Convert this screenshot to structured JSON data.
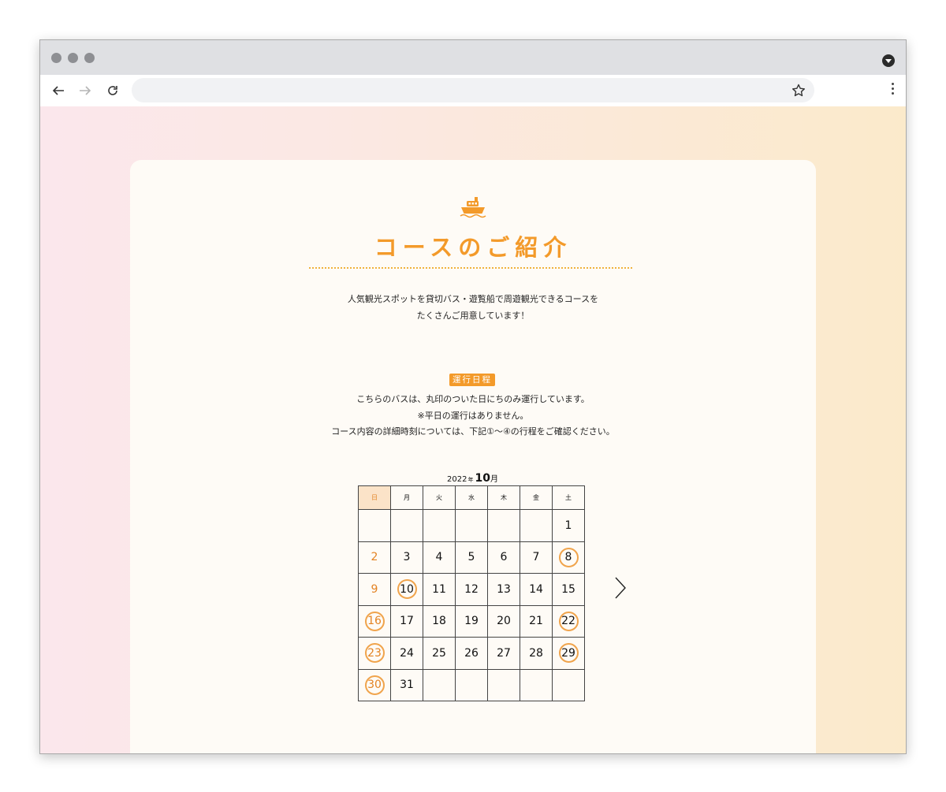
{
  "browser": {
    "address_value": "",
    "icons": [
      "back-arrow-icon",
      "forward-arrow-icon",
      "reload-icon",
      "star-icon",
      "menu-dots-icon",
      "profile-dropdown-icon"
    ]
  },
  "page": {
    "icon": "ship-icon",
    "title": "コースのご紹介",
    "intro_line1": "人気観光スポットを貸切バス・遊覧船で周遊観光できるコースを",
    "intro_line2": "たくさんご用意しています！",
    "badge": "運行日程",
    "note1": "こちらのバスは、丸印のついた日にちのみ運行しています。",
    "note2": "※平日の運行はありません。",
    "note3": "コース内容の詳細時刻については、下記①〜④の行程をご確認ください。",
    "accent_color": "#f39a2a"
  },
  "calendar": {
    "year": "2022",
    "year_suffix": "年",
    "month": "10",
    "month_suffix": "月",
    "weekdays": [
      "日",
      "月",
      "火",
      "水",
      "木",
      "金",
      "土"
    ],
    "weeks": [
      [
        "",
        "",
        "",
        "",
        "",
        "",
        "1"
      ],
      [
        "2",
        "3",
        "4",
        "5",
        "6",
        "7",
        "8"
      ],
      [
        "9",
        "10",
        "11",
        "12",
        "13",
        "14",
        "15"
      ],
      [
        "16",
        "17",
        "18",
        "19",
        "20",
        "21",
        "22"
      ],
      [
        "23",
        "24",
        "25",
        "26",
        "27",
        "28",
        "29"
      ],
      [
        "30",
        "31",
        "",
        "",
        "",
        "",
        ""
      ]
    ],
    "operating_days": [
      "8",
      "10",
      "16",
      "22",
      "23",
      "29",
      "30"
    ],
    "next_icon": "chevron-right-icon"
  }
}
